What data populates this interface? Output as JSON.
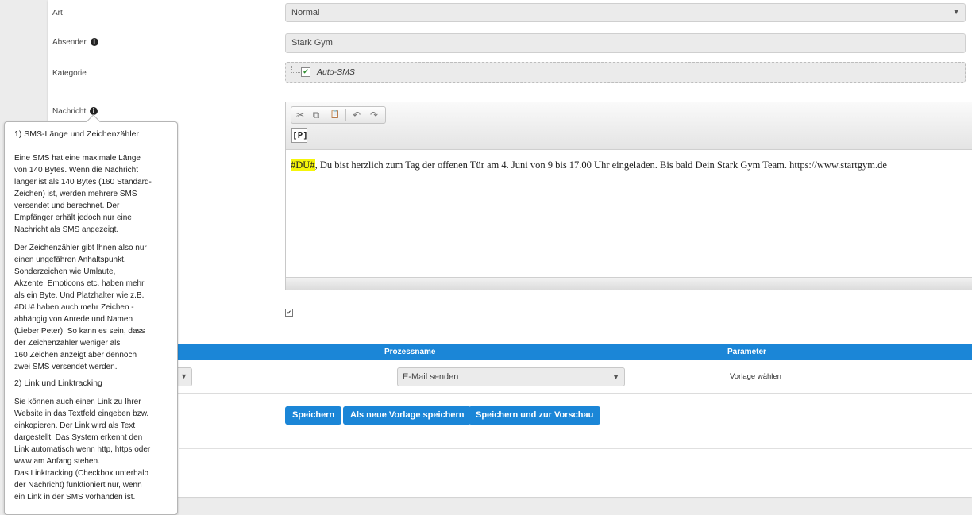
{
  "form": {
    "art_label": "Art",
    "art_value": "Normal",
    "absender_label": "Absender",
    "absender_value": "Stark Gym",
    "kategorie_label": "Kategorie",
    "kategorie_item": "Auto-SMS",
    "nachricht_label": "Nachricht",
    "info_glyph": "i"
  },
  "editor": {
    "toolbar": {
      "cut_icon": "✂",
      "copy_icon": "⧉",
      "paste_icon": "📋",
      "undo_icon": "↶",
      "redo_icon": "↷",
      "p_button": "P"
    },
    "placeholder_tag": "#DU#",
    "message_rest": ", Du bist herzlich zum Tag der offenen Tür am 4. Juni von 9 bis 17.00 Uhr eingeladen. Bis bald Dein Stark Gym Team. https://www.startgym.de"
  },
  "linktracking_checkbox": {
    "checked": true
  },
  "table": {
    "headers": [
      "",
      "Prozessname",
      "Parameter"
    ],
    "row": {
      "prozess": "E-Mail senden",
      "parameter": "Vorlage wählen"
    }
  },
  "buttons": {
    "save": "Speichern",
    "save_template": "Als neue Vorlage speichern",
    "save_preview": "Speichern und zur Vorschau"
  },
  "tooltip": {
    "title1": "1) SMS-Länge und Zeichenzähler",
    "p1": "Eine SMS hat eine maximale Länge\nvon 140 Bytes. Wenn die Nachricht\nlänger ist als 140 Bytes (160 Standard-\nZeichen) ist, werden mehrere SMS\nversendet und berechnet. Der\nEmpfänger erhält jedoch nur eine\nNachricht als SMS angezeigt.",
    "p2": "Der Zeichenzähler gibt Ihnen also nur\neinen ungefähren Anhaltspunkt.\nSonderzeichen wie Umlaute,\nAkzente, Emoticons etc. haben mehr\nals ein Byte. Und Platzhalter wie z.B.\n#DU# haben auch mehr Zeichen -\nabhängig von Anrede und Namen\n(Lieber Peter). So kann es sein, dass\nder Zeichenzähler weniger als\n160 Zeichen anzeigt aber dennoch\nzwei SMS versendet werden.",
    "title2": "2) Link und Linktracking",
    "p3": "Sie können auch einen Link zu Ihrer\nWebsite in das Textfeld eingeben bzw.\neinkopieren. Der Link wird als Text\ndargestellt. Das System erkennt den\nLink automatisch wenn http, https oder\nwww am Anfang stehen.\nDas Linktracking (Checkbox unterhalb\nder Nachricht) funktioniert nur, wenn\nein Link in der SMS vorhanden ist."
  },
  "colors": {
    "accent": "#1b86d7",
    "highlight": "#f5f50a",
    "field_bg": "#ebebeb"
  }
}
